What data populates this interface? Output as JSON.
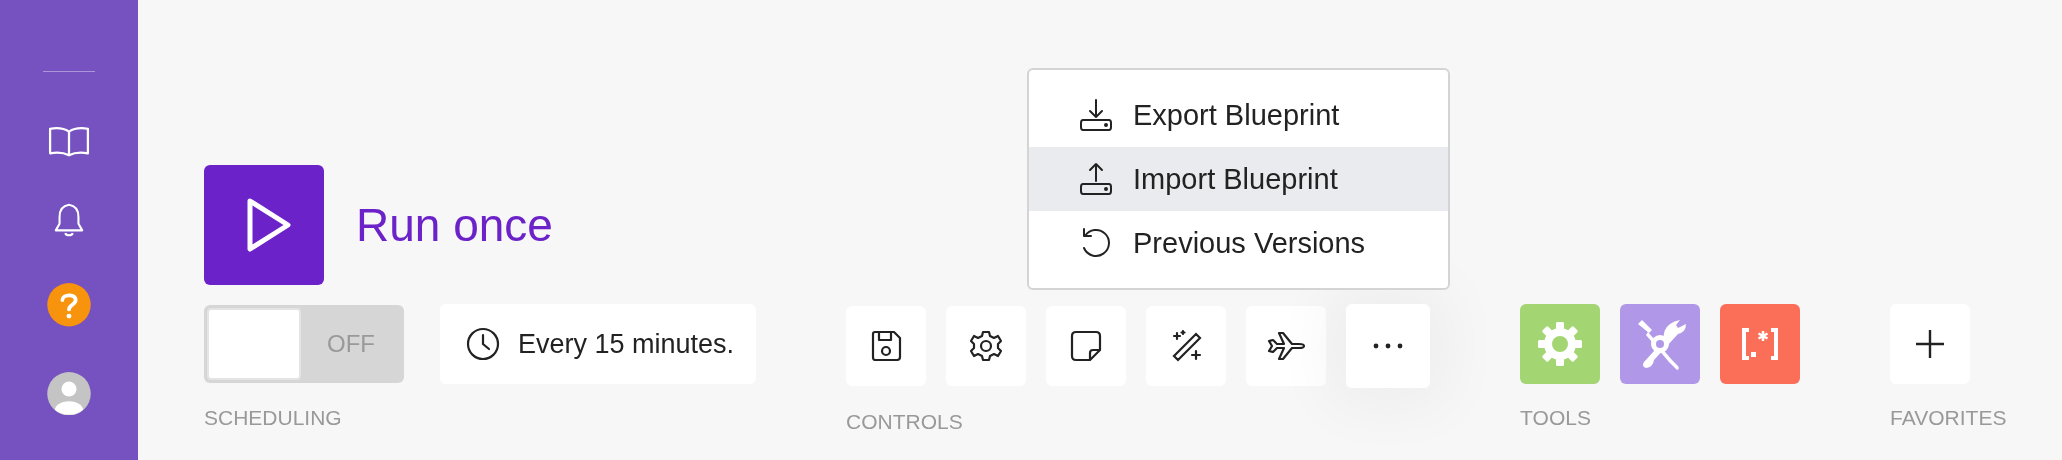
{
  "sidebar": {
    "items": [
      {
        "kind": "book"
      },
      {
        "kind": "bell"
      },
      {
        "kind": "help"
      },
      {
        "kind": "avatar"
      }
    ]
  },
  "run": {
    "label": "Run once"
  },
  "scheduling": {
    "on": false,
    "state_label": "OFF",
    "interval": "Every 15 minutes.",
    "caption": "SCHEDULING"
  },
  "controls": {
    "caption": "CONTROLS",
    "buttons": [
      {
        "kind": "save",
        "selected": false
      },
      {
        "kind": "settings",
        "selected": false
      },
      {
        "kind": "note",
        "selected": false
      },
      {
        "kind": "magic",
        "selected": false
      },
      {
        "kind": "airplane",
        "selected": false
      },
      {
        "kind": "more",
        "selected": true
      }
    ]
  },
  "menu": {
    "items": [
      {
        "kind": "export",
        "label": "Export Blueprint",
        "selected": false
      },
      {
        "kind": "import",
        "label": "Import Blueprint",
        "selected": true
      },
      {
        "kind": "history",
        "label": "Previous Versions",
        "selected": false
      }
    ]
  },
  "tools": {
    "caption": "TOOLS",
    "items": [
      {
        "kind": "gear",
        "color": "#a3d572"
      },
      {
        "kind": "tools",
        "color": "#b097e8"
      },
      {
        "kind": "regex",
        "color": "#fb6e57"
      }
    ]
  },
  "favorites": {
    "caption": "FAVORITES"
  }
}
